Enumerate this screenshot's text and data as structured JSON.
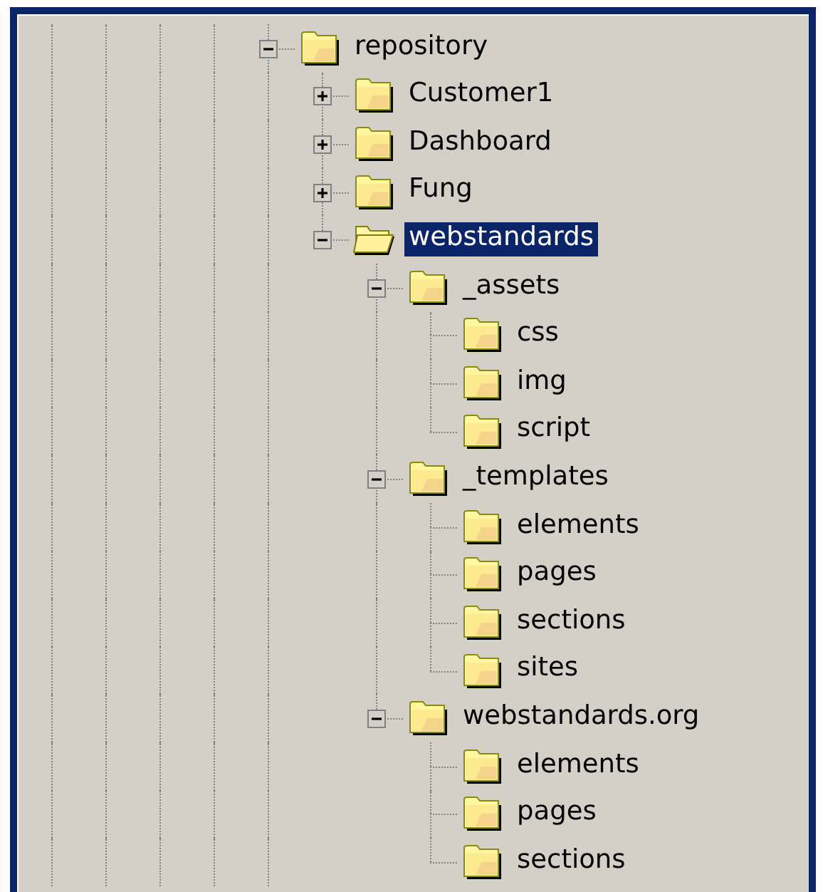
{
  "tree": [
    {
      "label": "repository",
      "expanded": true,
      "selected": false,
      "children": [
        {
          "label": "Customer1",
          "expanded": false,
          "selected": false
        },
        {
          "label": "Dashboard",
          "expanded": false,
          "selected": false
        },
        {
          "label": "Fung",
          "expanded": false,
          "selected": false
        },
        {
          "label": "webstandards",
          "expanded": true,
          "selected": true,
          "children": [
            {
              "label": "_assets",
              "expanded": true,
              "selected": false,
              "children": [
                {
                  "label": "css",
                  "selected": false
                },
                {
                  "label": "img",
                  "selected": false
                },
                {
                  "label": "script",
                  "selected": false
                }
              ]
            },
            {
              "label": "_templates",
              "expanded": true,
              "selected": false,
              "children": [
                {
                  "label": "elements",
                  "selected": false
                },
                {
                  "label": "pages",
                  "selected": false
                },
                {
                  "label": "sections",
                  "selected": false
                },
                {
                  "label": "sites",
                  "selected": false
                }
              ]
            },
            {
              "label": "webstandards.org",
              "expanded": true,
              "selected": false,
              "children": [
                {
                  "label": "elements",
                  "selected": false
                },
                {
                  "label": "pages",
                  "selected": false
                },
                {
                  "label": "sections",
                  "selected": false
                }
              ]
            }
          ]
        }
      ]
    }
  ]
}
